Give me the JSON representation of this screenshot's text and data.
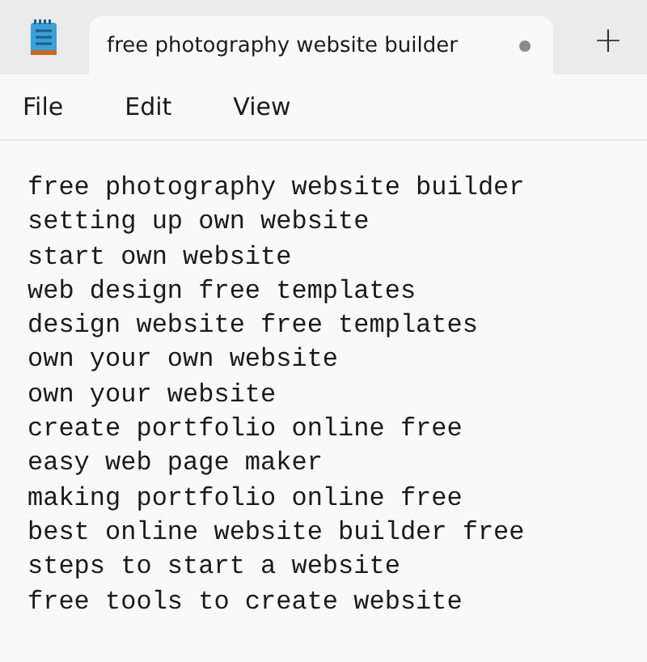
{
  "tabs": [
    {
      "title": "free photography website builder",
      "selected": true,
      "modified": true
    }
  ],
  "new_tab_button": "+",
  "menu": [
    "File",
    "Edit",
    "View"
  ],
  "lines": [
    "free photography website builder",
    "setting up own website",
    "start own website",
    "web design free templates",
    "design website free templates",
    "own your own website",
    "own your website",
    "create portfolio online free",
    "easy web page maker",
    "making portfolio online free",
    "best online website builder free",
    "steps to start a website",
    "free tools to create website"
  ]
}
